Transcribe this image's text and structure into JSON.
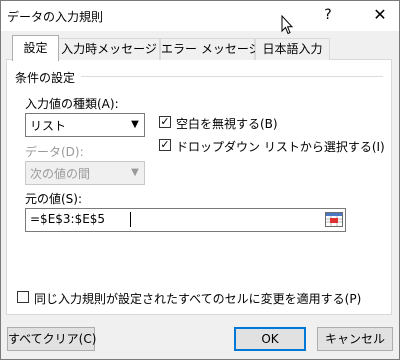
{
  "window": {
    "title": "データの入力規則",
    "help_label": "?",
    "close_label": "✕"
  },
  "tabs": [
    {
      "label": "設定",
      "active": true
    },
    {
      "label": "入力時メッセージ",
      "active": false
    },
    {
      "label": "エラー メッセージ",
      "active": false
    },
    {
      "label": "日本語入力",
      "active": false
    }
  ],
  "settings": {
    "section_title": "条件の設定",
    "allow_label": "入力値の種類(A):",
    "allow_value": "リスト",
    "data_label": "データ(D):",
    "data_value": "次の値の間",
    "ignore_blank_label": "空白を無視する(B)",
    "ignore_blank_checked": true,
    "in_cell_dropdown_label": "ドロップダウン リストから選択する(I)",
    "in_cell_dropdown_checked": true,
    "source_label": "元の値(S):",
    "source_value": "=$E$3:$E$5",
    "apply_all_label": "同じ入力規則が設定されたすべてのセルに変更を適用する(P)",
    "apply_all_checked": false
  },
  "buttons": {
    "clear_all": "すべてクリア(C)",
    "ok": "OK",
    "cancel": "キャンセル"
  }
}
